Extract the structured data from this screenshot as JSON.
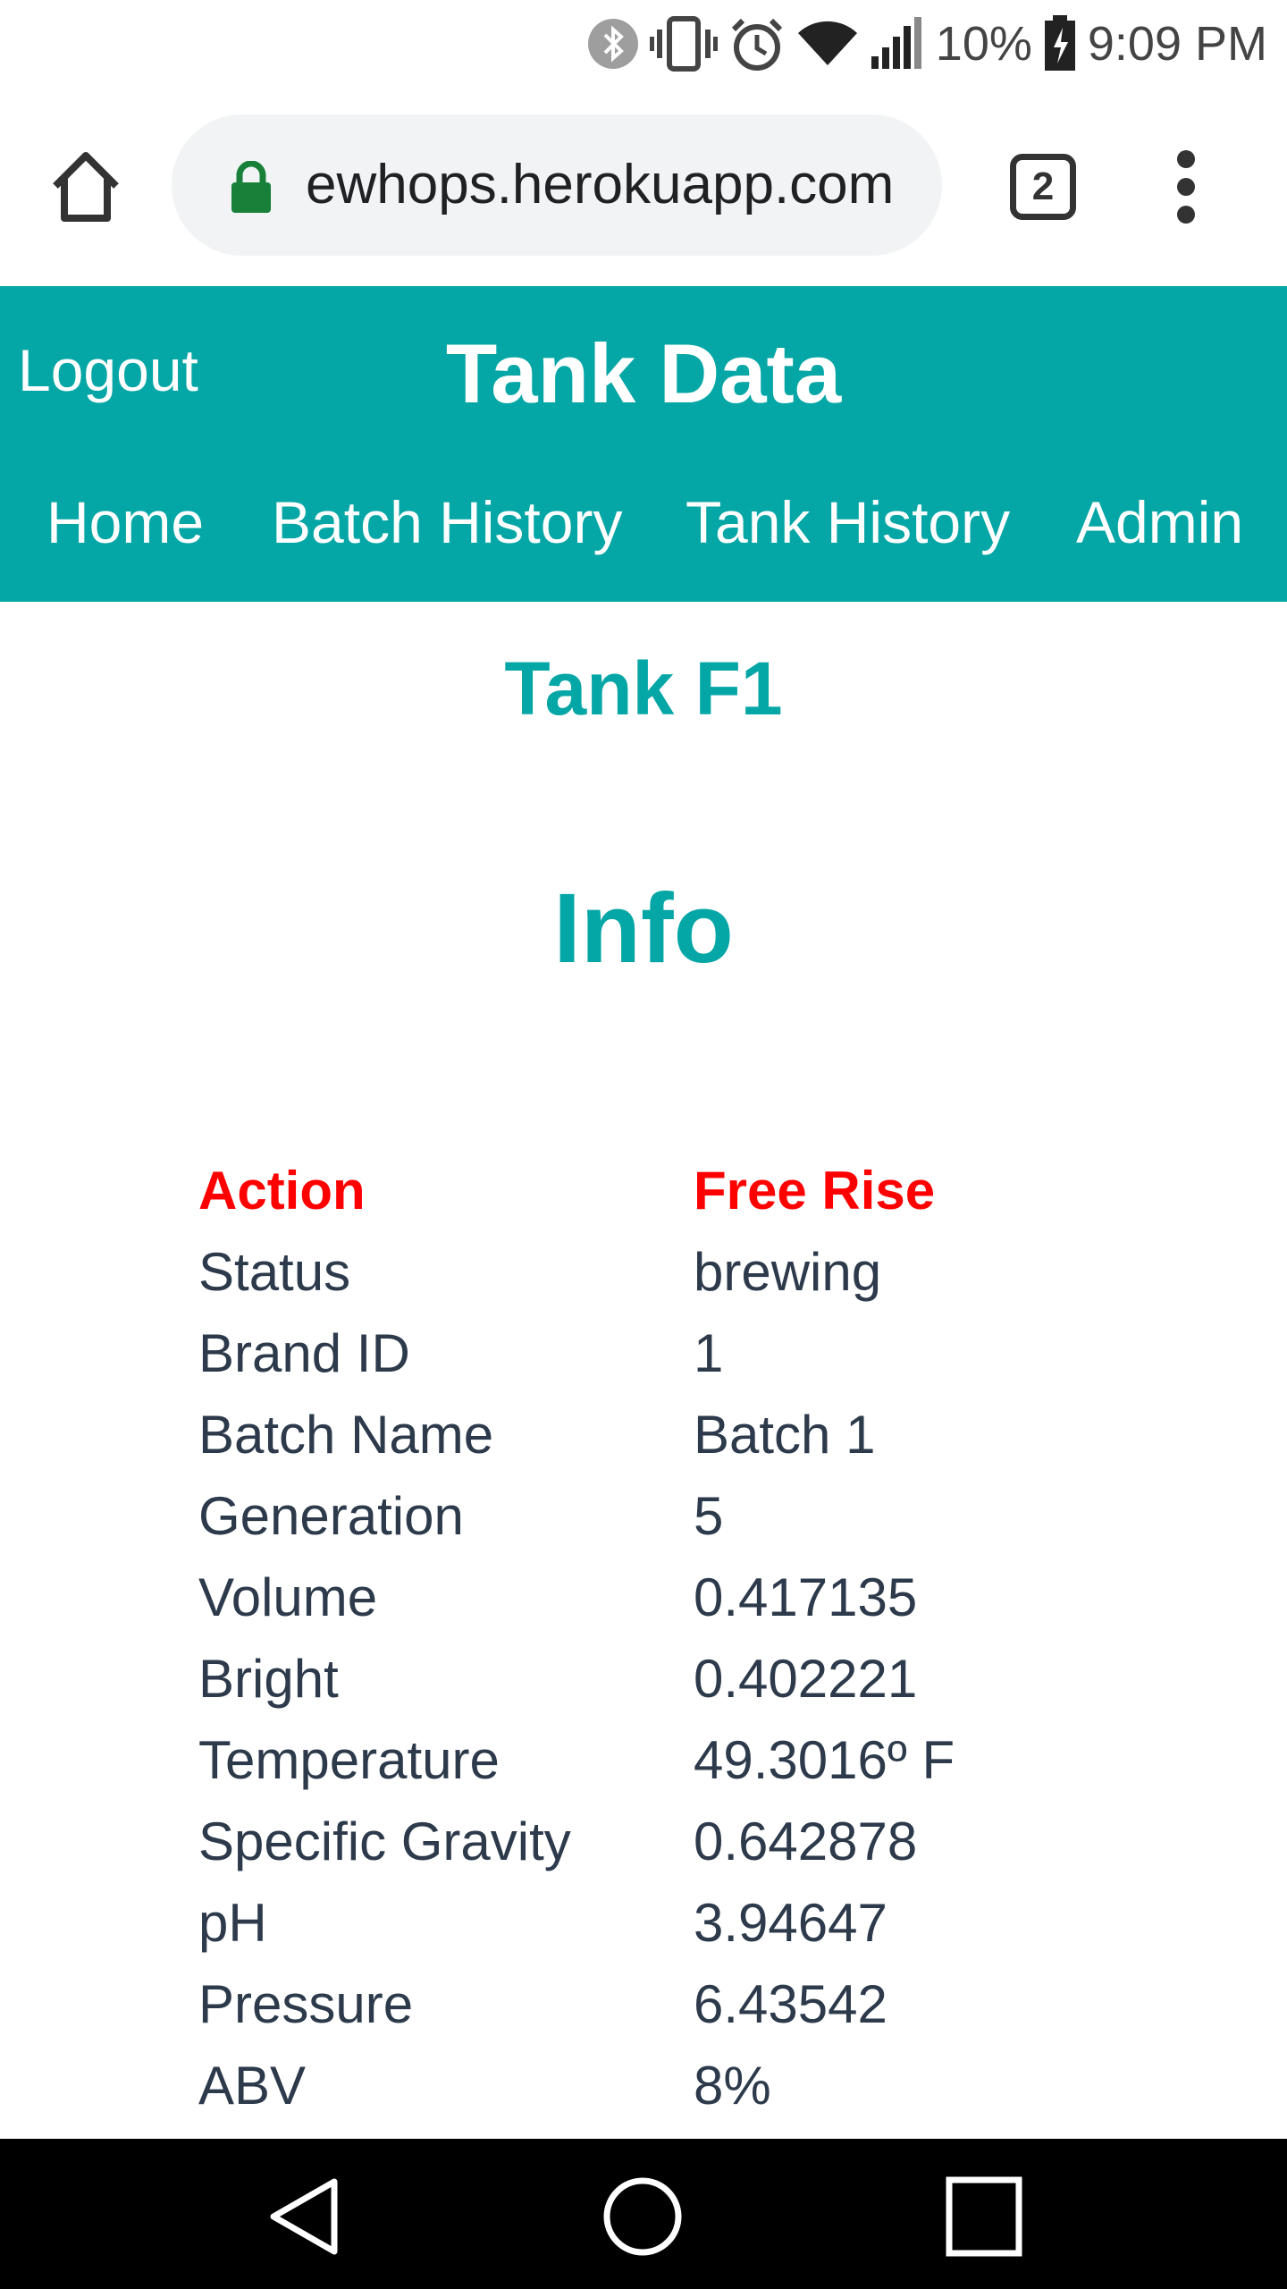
{
  "status_bar": {
    "battery_percent": "10%",
    "time": "9:09 PM",
    "icons": [
      "bluetooth-icon",
      "vibrate-icon",
      "alarm-icon",
      "wifi-icon",
      "signal-icon",
      "battery-icon"
    ]
  },
  "browser": {
    "url": "ewhops.herokuapp.com",
    "tab_count": "2"
  },
  "header": {
    "logout_label": "Logout",
    "title": "Tank Data",
    "nav": [
      "Home",
      "Batch History",
      "Tank History",
      "Admin"
    ]
  },
  "page": {
    "tank_name": "Tank F1",
    "section_heading": "Info"
  },
  "info": {
    "action": {
      "label": "Action",
      "value": "Free Rise"
    },
    "rows": [
      {
        "label": "Status",
        "value": "brewing"
      },
      {
        "label": "Brand ID",
        "value": "1"
      },
      {
        "label": "Batch Name",
        "value": "Batch 1"
      },
      {
        "label": "Generation",
        "value": "5"
      },
      {
        "label": "Volume",
        "value": "0.417135"
      },
      {
        "label": "Bright",
        "value": "0.402221"
      },
      {
        "label": "Temperature",
        "value": "49.3016º F"
      },
      {
        "label": "Specific Gravity",
        "value": "0.642878"
      },
      {
        "label": "pH",
        "value": "3.94647"
      },
      {
        "label": "Pressure",
        "value": "6.43542"
      },
      {
        "label": "ABV",
        "value": "8%"
      }
    ]
  },
  "colors": {
    "accent": "#05a6a6",
    "action": "#ff0000",
    "text": "#2d3a4b"
  }
}
